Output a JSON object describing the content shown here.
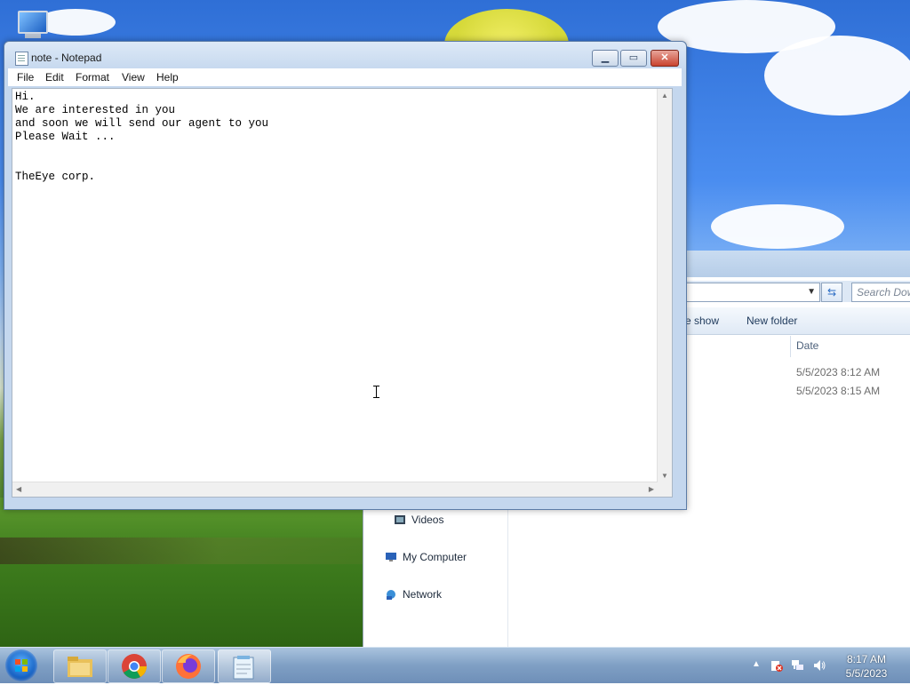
{
  "notepad": {
    "title": "note - Notepad",
    "menu": [
      "File",
      "Edit",
      "Format",
      "View",
      "Help"
    ],
    "content": "Hi.\nWe are interested in you\nand soon we will send our agent to you\nPlease Wait ...\n\n\nTheEye corp."
  },
  "explorer": {
    "search_placeholder": "Search Downloads",
    "toolbar": {
      "slideshow_partial": "e show",
      "new_folder": "New folder"
    },
    "column_date": "Date",
    "files": [
      {
        "date": "5/5/2023 8:12 AM"
      },
      {
        "date": "5/5/2023 8:15 AM"
      }
    ],
    "nav": [
      {
        "label": "Videos",
        "icon": "videos-icon"
      },
      {
        "label": "My Computer",
        "icon": "computer-icon"
      },
      {
        "label": "Network",
        "icon": "network-icon"
      }
    ]
  },
  "taskbar": {
    "apps": [
      "file-explorer-icon",
      "chrome-icon",
      "firefox-icon",
      "notepad-icon"
    ],
    "clock": {
      "time": "8:17 AM",
      "date": "5/5/2023"
    }
  }
}
